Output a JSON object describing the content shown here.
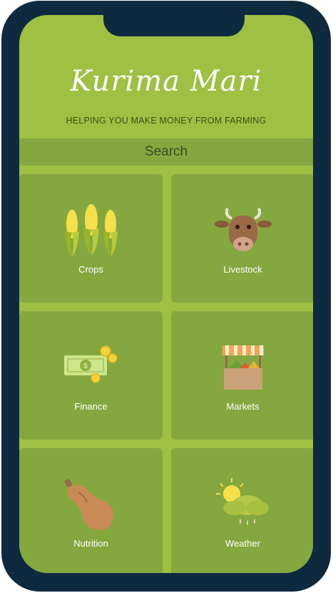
{
  "app": {
    "title": "Kurima Mari",
    "tagline": "HELPING YOU MAKE MONEY FROM FARMING"
  },
  "search": {
    "label": "Search"
  },
  "categories": [
    {
      "label": "Crops",
      "icon": "corn-icon"
    },
    {
      "label": "Livestock",
      "icon": "cow-icon"
    },
    {
      "label": "Finance",
      "icon": "money-icon"
    },
    {
      "label": "Markets",
      "icon": "market-stall-icon"
    },
    {
      "label": "Nutrition",
      "icon": "squash-icon"
    },
    {
      "label": "Weather",
      "icon": "weather-icon"
    }
  ],
  "colors": {
    "screen": "#9ec043",
    "tile": "#84a83f",
    "frame": "#0f2a3f"
  }
}
